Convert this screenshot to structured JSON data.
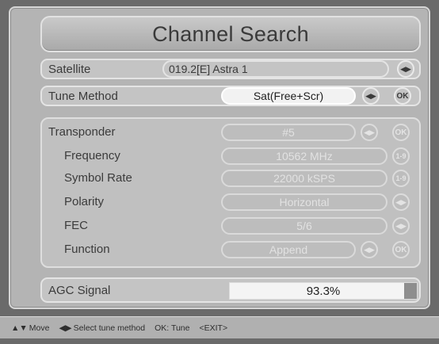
{
  "title": "Channel Search",
  "satellite": {
    "label": "Satellite",
    "value": "019.2[E] Astra 1"
  },
  "tune_method": {
    "label": "Tune Method",
    "value": "Sat(Free+Scr)",
    "ok": "OK"
  },
  "transponder": {
    "label": "Transponder",
    "value": "#5",
    "ok": "OK",
    "fields": [
      {
        "label": "Frequency",
        "value": "10562 MHz"
      },
      {
        "label": "Symbol Rate",
        "value": "22000 kSPS"
      },
      {
        "label": "Polarity",
        "value": "Horizontal"
      },
      {
        "label": "FEC",
        "value": "5/6"
      },
      {
        "label": "Function",
        "value": "Append"
      }
    ],
    "function_ok": "OK"
  },
  "agc": {
    "label": "AGC Signal",
    "value_text": "93.3%",
    "level": 0.933
  },
  "help": {
    "move": "Move",
    "select": "Select tune method",
    "ok_tune": "OK: Tune",
    "exit": "<EXIT>"
  },
  "icons": {
    "left_right": "left-right-arrows",
    "up_down": "up-down-arrows"
  }
}
